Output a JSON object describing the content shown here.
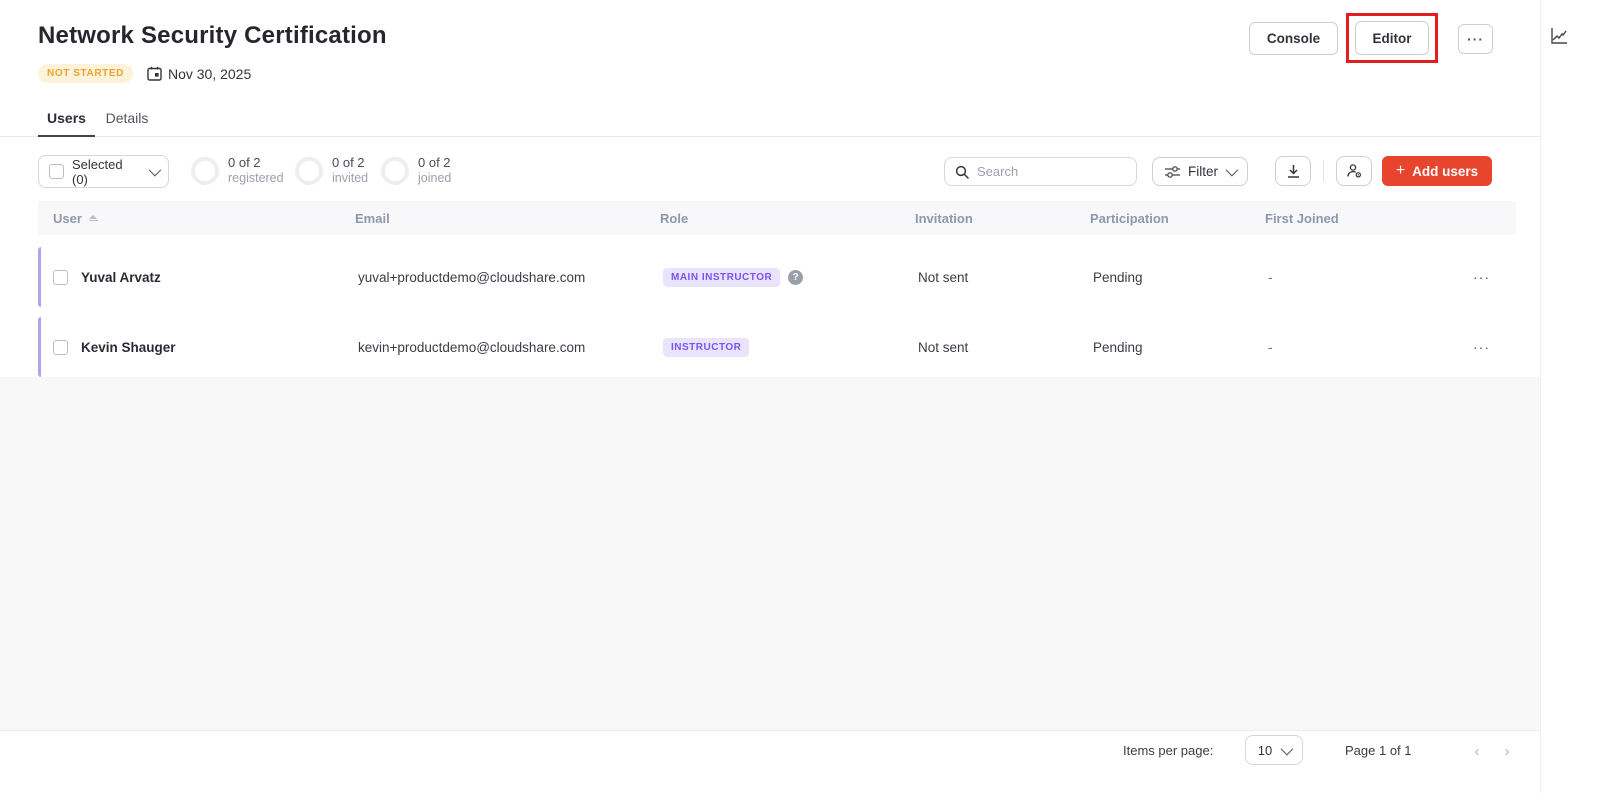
{
  "header": {
    "title": "Network Security Certification",
    "status_badge": "NOT STARTED",
    "date": "Nov 30, 2025",
    "console_label": "Console",
    "editor_label": "Editor",
    "more_icon": "···"
  },
  "tabs": {
    "users": "Users",
    "details": "Details"
  },
  "toolbar": {
    "selected_label": "Selected (0)",
    "stats": [
      {
        "value": "0  of 2",
        "label": "registered"
      },
      {
        "value": "0  of 2",
        "label": "invited"
      },
      {
        "value": "0  of 2",
        "label": "joined"
      }
    ],
    "search_placeholder": "Search",
    "filter_label": "Filter",
    "add_users_label": "Add users",
    "add_users_plus": "+"
  },
  "table": {
    "columns": {
      "user": "User",
      "email": "Email",
      "role": "Role",
      "invitation": "Invitation",
      "participation": "Participation",
      "first_joined": "First Joined"
    },
    "rows": [
      {
        "name": "Yuval Arvatz",
        "email": "yuval+productdemo@cloudshare.com",
        "role": "MAIN INSTRUCTOR",
        "help": "?",
        "invitation": "Not sent",
        "participation": "Pending",
        "first_joined": "-",
        "more_icon": "···"
      },
      {
        "name": "Kevin Shauger",
        "email": "kevin+productdemo@cloudshare.com",
        "role": "INSTRUCTOR",
        "invitation": "Not sent",
        "participation": "Pending",
        "first_joined": "-",
        "more_icon": "···"
      }
    ]
  },
  "pagination": {
    "items_per_page_label": "Items per page:",
    "items_per_page_value": "10",
    "page_label": "Page 1 of 1",
    "prev_icon": "‹",
    "next_icon": "›"
  },
  "colors": {
    "accent_red": "#e8452f",
    "highlight_red": "#e01f1f",
    "status_orange_text": "#efa12f",
    "status_orange_bg": "#fdf3da",
    "role_purple_text": "#7a52f4",
    "role_purple_bg": "#e9e4fb",
    "row_accent_purple": "#b1a3f0"
  }
}
